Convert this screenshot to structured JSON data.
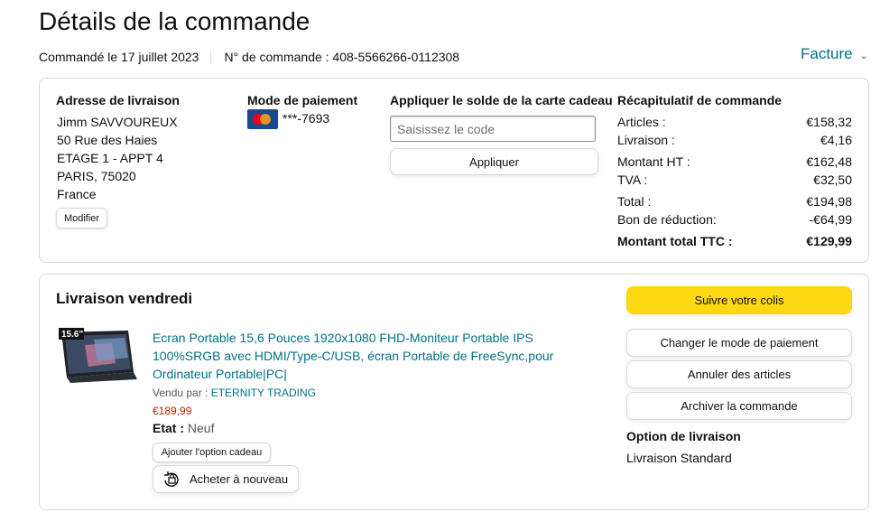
{
  "page": {
    "title": "Détails de la commande",
    "ordered_on": "Commandé le 17 juillet 2023",
    "order_number": "N° de commande : 408-5566266-0112308",
    "invoice_label": "Facture"
  },
  "shipping": {
    "title": "Adresse de livraison",
    "lines": [
      "Jimm SAVVOUREUX",
      "50 Rue des Haies",
      "ETAGE 1 - APPT 4",
      "PARIS, 75020",
      "France"
    ],
    "edit_label": "Modifier"
  },
  "payment": {
    "title": "Mode de paiement",
    "card_icon": "mastercard-icon",
    "card_masked": "***-7693"
  },
  "gift_card": {
    "title": "Appliquer le solde de la carte cadeau",
    "placeholder": "Saisissez le code",
    "apply_label": "Appliquer"
  },
  "summary": {
    "title": "Récapitulatif de commande",
    "rows": [
      {
        "label": "Articles :",
        "value": "€158,32"
      },
      {
        "label": "Livraison :",
        "value": "€4,16"
      },
      {
        "label": "Montant HT :",
        "value": "€162,48"
      },
      {
        "label": "TVA :",
        "value": "€32,50"
      },
      {
        "label": "Total :",
        "value": "€194,98"
      },
      {
        "label": "Bon de réduction:",
        "value": "-€64,99"
      },
      {
        "label": "Montant total TTC :",
        "value": "€129,99"
      }
    ]
  },
  "delivery": {
    "title": "Livraison vendredi",
    "product": {
      "image_badge": "15.6\"",
      "name": "Ecran Portable 15,6 Pouces 1920x1080 FHD-Moniteur Portable IPS 100%SRGB avec HDMI/Type-C/USB, écran Portable de FreeSync,pour Ordinateur Portable|PC|",
      "vendor_prefix": "Vendu par : ",
      "vendor_name": "ETERNITY TRADING",
      "price": "€189,99",
      "condition_label": "Etat :",
      "condition_value": "Neuf",
      "gift_option_label": "Ajouter l'option cadeau",
      "rebuy_label": "Acheter à nouveau"
    },
    "actions": {
      "track": "Suivre votre colis",
      "change_payment": "Changer le mode de paiement",
      "cancel": "Annuler des articles",
      "archive": "Archiver la commande"
    },
    "option_title": "Option de livraison",
    "option_value": "Livraison Standard"
  },
  "colors": {
    "link": "#007185",
    "price": "#b12704",
    "primary_button": "#ffd814",
    "border": "#d5d9d9"
  }
}
